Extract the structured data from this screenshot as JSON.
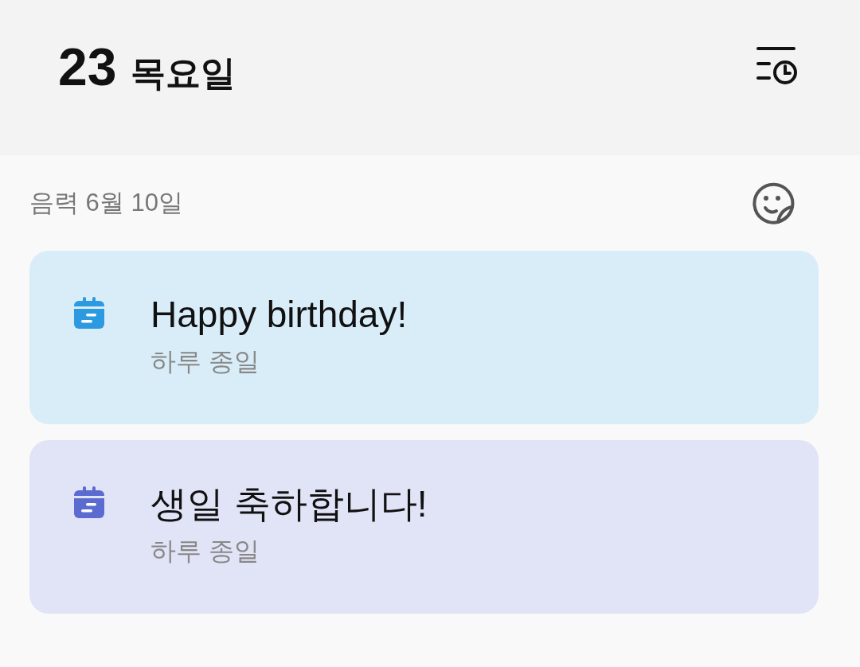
{
  "header": {
    "day": "23",
    "weekday": "목요일"
  },
  "lunar_date": "음력 6월 10일",
  "events": [
    {
      "title": "Happy birthday!",
      "subtitle": "하루 종일",
      "color": "#2b9ae0"
    },
    {
      "title": "생일 축하합니다!",
      "subtitle": "하루 종일",
      "color": "#5b6bd0"
    }
  ]
}
